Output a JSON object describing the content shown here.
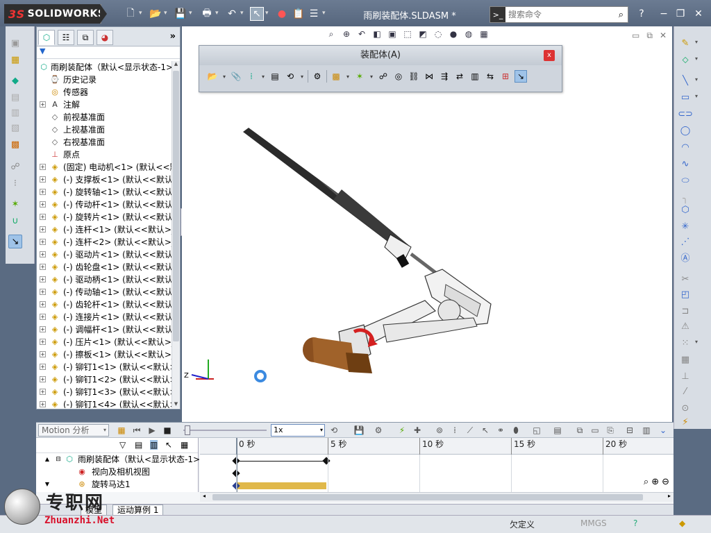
{
  "app": {
    "brand": "SOLIDWORKS",
    "brand_prefix": "3S",
    "document_title": "雨刷装配体.SLDASM *",
    "search_placeholder": "搜索命令",
    "help_label": "?",
    "win_min": "−",
    "win_max": "❐",
    "win_close": "✕"
  },
  "feature_tree": {
    "expand_label": "»",
    "filter_label": "▼",
    "root": "雨刷装配体（默认<显示状态-1>",
    "items": [
      {
        "label": "历史记录",
        "icon": "history-icon",
        "expandable": false
      },
      {
        "label": "传感器",
        "icon": "sensor-icon",
        "expandable": false
      },
      {
        "label": "注解",
        "icon": "annotation-icon",
        "expandable": true
      },
      {
        "label": "前视基准面",
        "icon": "plane-icon",
        "expandable": false
      },
      {
        "label": "上视基准面",
        "icon": "plane-icon",
        "expandable": false
      },
      {
        "label": "右视基准面",
        "icon": "plane-icon",
        "expandable": false
      },
      {
        "label": "原点",
        "icon": "origin-icon",
        "expandable": false
      },
      {
        "label": "(固定) 电动机<1> (默认<<默",
        "icon": "part-icon",
        "expandable": true
      },
      {
        "label": "(-) 支撑板<1> (默认<<默认",
        "icon": "part-icon",
        "expandable": true
      },
      {
        "label": "(-) 旋转轴<1> (默认<<默认",
        "icon": "part-icon",
        "expandable": true
      },
      {
        "label": "(-) 传动杆<1> (默认<<默认",
        "icon": "part-icon",
        "expandable": true
      },
      {
        "label": "(-) 旋转片<1> (默认<<默认",
        "icon": "part-icon",
        "expandable": true
      },
      {
        "label": "(-) 连杆<1> (默认<<默认>_",
        "icon": "part-icon",
        "expandable": true
      },
      {
        "label": "(-) 连杆<2> (默认<<默认>_",
        "icon": "part-icon",
        "expandable": true
      },
      {
        "label": "(-) 驱动片<1> (默认<<默认",
        "icon": "part-icon",
        "expandable": true
      },
      {
        "label": "(-) 齿轮盘<1> (默认<<默认",
        "icon": "part-icon",
        "expandable": true
      },
      {
        "label": "(-) 驱动柄<1> (默认<<默认",
        "icon": "part-icon",
        "expandable": true
      },
      {
        "label": "(-) 传动轴<1> (默认<<默认",
        "icon": "part-icon",
        "expandable": true
      },
      {
        "label": "(-) 齿轮杆<1> (默认<<默认",
        "icon": "part-icon",
        "expandable": true
      },
      {
        "label": "(-) 连接片<1> (默认<<默认",
        "icon": "part-icon",
        "expandable": true
      },
      {
        "label": "(-) 调幅杆<1> (默认<<默认",
        "icon": "part-icon",
        "expandable": true
      },
      {
        "label": "(-) 压片<1> (默认<<默认>_",
        "icon": "part-icon",
        "expandable": true
      },
      {
        "label": "(-) 擦板<1> (默认<<默认>_",
        "icon": "part-icon",
        "expandable": true
      },
      {
        "label": "(-) 铆钉1<1> (默认<<默认>",
        "icon": "part-icon",
        "expandable": true
      },
      {
        "label": "(-) 铆钉1<2> (默认<<默认>",
        "icon": "part-icon",
        "expandable": true
      },
      {
        "label": "(-) 铆钉1<3> (默认<<默认>",
        "icon": "part-icon",
        "expandable": true
      },
      {
        "label": "(-) 铆钉1<4> (默认<<默认>",
        "icon": "part-icon",
        "expandable": true
      }
    ]
  },
  "floating_toolbar": {
    "title": "装配体(A)",
    "close": "x"
  },
  "graphics": {
    "triad_z": "Z"
  },
  "motion": {
    "study_type": "Motion 分析",
    "speed": "1x",
    "ticks": [
      "0 秒",
      "5 秒",
      "10 秒",
      "15 秒",
      "20 秒"
    ],
    "tree_root": "雨刷装配体（默认<显示状态-1>",
    "rows": [
      {
        "label": "视向及相机视图",
        "icon": "camera-view-icon"
      },
      {
        "label": "旋转马达1",
        "icon": "rotary-motor-icon"
      }
    ]
  },
  "study_tabs": {
    "model": "模型",
    "study": "运动算例 1"
  },
  "status": {
    "state": "欠定义",
    "units": "MMGS",
    "help": "?"
  },
  "watermark": {
    "cn": "专职网",
    "en": "Zhuanzhi.Net"
  },
  "colors": {
    "accent": "#3b8ae0",
    "motor": "#a0622a",
    "wiper": "#222222",
    "keybar": "#e0b84a"
  }
}
